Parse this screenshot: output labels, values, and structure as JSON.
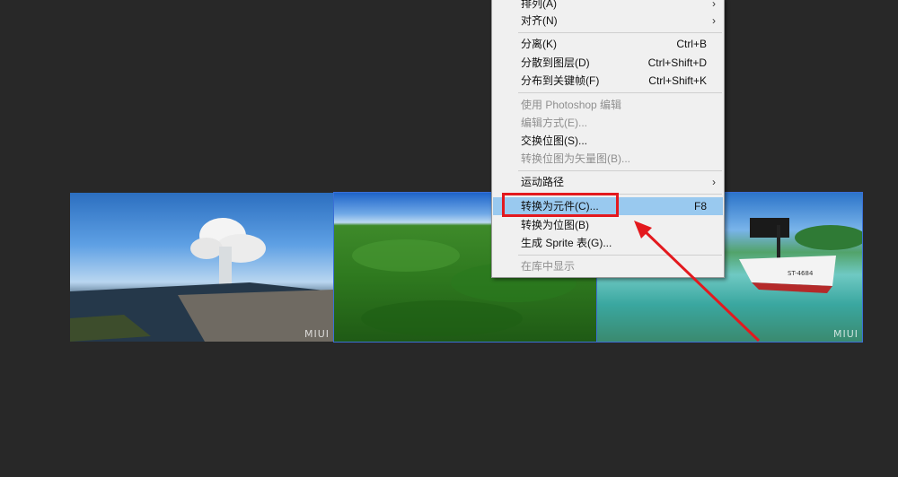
{
  "watermarks": [
    "MIUI",
    "MIUI"
  ],
  "context_menu": {
    "items": {
      "arrange": {
        "label": "排列(A)",
        "submenu": true
      },
      "align": {
        "label": "对齐(N)",
        "submenu": true
      },
      "break_apart": {
        "label": "分离(K)",
        "shortcut": "Ctrl+B"
      },
      "distribute_layers": {
        "label": "分散到图层(D)",
        "shortcut": "Ctrl+Shift+D"
      },
      "distribute_keyframes": {
        "label": "分布到关键帧(F)",
        "shortcut": "Ctrl+Shift+K"
      },
      "edit_photoshop": {
        "label": "使用 Photoshop 编辑",
        "disabled": true
      },
      "edit_with": {
        "label": "编辑方式(E)...",
        "disabled": true
      },
      "swap_bitmap": {
        "label": "交换位图(S)..."
      },
      "trace_bitmap": {
        "label": "转换位图为矢量图(B)...",
        "disabled": true
      },
      "motion_path": {
        "label": "运动路径",
        "submenu": true
      },
      "convert_symbol": {
        "label": "转换为元件(C)...",
        "shortcut": "F8",
        "highlighted": true
      },
      "convert_bitmap": {
        "label": "转换为位图(B)"
      },
      "sprite_sheet": {
        "label": "生成 Sprite 表(G)..."
      },
      "show_in_library": {
        "label": "在库中显示",
        "disabled": true
      }
    }
  },
  "colors": {
    "background": "#282828",
    "menu_bg": "#f0f0f0",
    "highlight": "#99c9ef",
    "annotation": "#e3191e",
    "selection": "#3b6fd6"
  }
}
